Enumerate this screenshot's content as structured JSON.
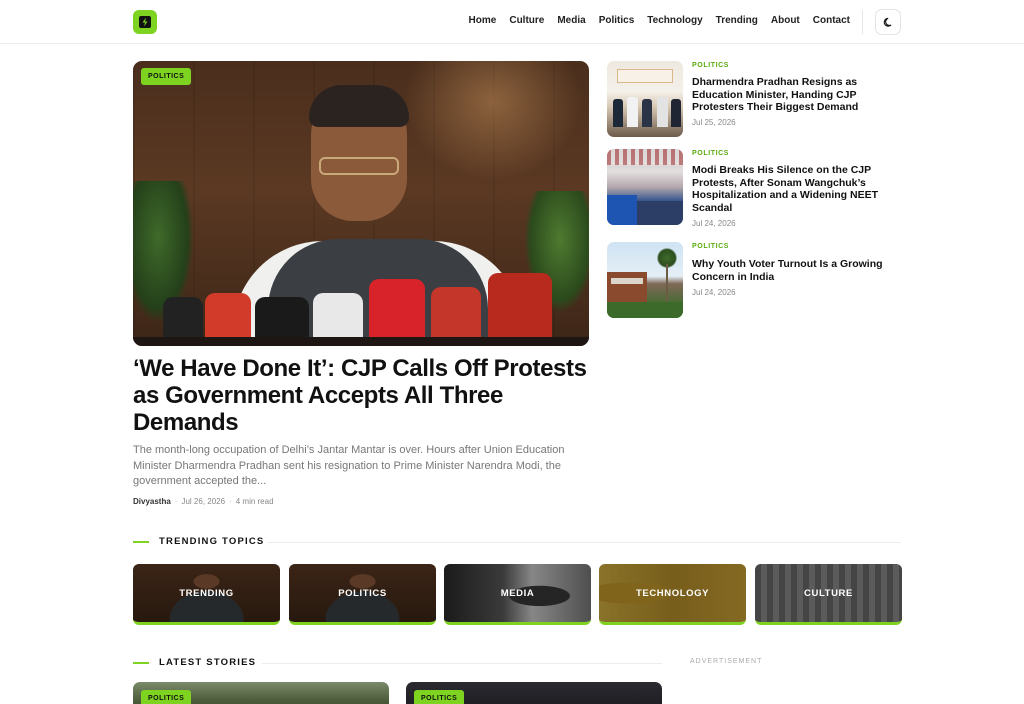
{
  "header": {
    "logo_icon": "lightning-bolt-icon",
    "nav": [
      "Home",
      "Culture",
      "Media",
      "Politics",
      "Technology",
      "Trending",
      "About",
      "Contact"
    ],
    "theme_icon": "moon-icon"
  },
  "hero": {
    "category": "POLITICS",
    "title": "‘We Have Done It’: CJP Calls Off Protests as Government Accepts All Three Demands",
    "excerpt": "The month-long occupation of Delhi’s Jantar Mantar is over. Hours after Union Education Minister Dharmendra Pradhan sent his resignation to Prime Minister Narendra Modi, the government accepted the...",
    "author": "Divyastha",
    "date": "Jul 26, 2026",
    "read_time": "4 min read"
  },
  "side_stories": [
    {
      "category": "POLITICS",
      "title": "Dharmendra Pradhan Resigns as Education Minister, Handing CJP Protesters Their Biggest Demand",
      "date": "Jul 25, 2026"
    },
    {
      "category": "POLITICS",
      "title": "Modi Breaks His Silence on the CJP Protests, After Sonam Wangchuk’s Hospitalization and a Widening NEET Scandal",
      "date": "Jul 24, 2026"
    },
    {
      "category": "POLITICS",
      "title": "Why Youth Voter Turnout Is a Growing Concern in India",
      "date": "Jul 24, 2026"
    }
  ],
  "trending": {
    "heading": "TRENDING TOPICS",
    "topics": [
      "TRENDING",
      "POLITICS",
      "MEDIA",
      "TECHNOLOGY",
      "CULTURE"
    ]
  },
  "latest": {
    "heading": "LATEST STORIES",
    "cards": [
      {
        "category": "POLITICS"
      },
      {
        "category": "POLITICS"
      }
    ]
  },
  "advertisement_label": "ADVERTISEMENT",
  "colors": {
    "accent": "#7ed321",
    "category_text": "#5aab10"
  }
}
